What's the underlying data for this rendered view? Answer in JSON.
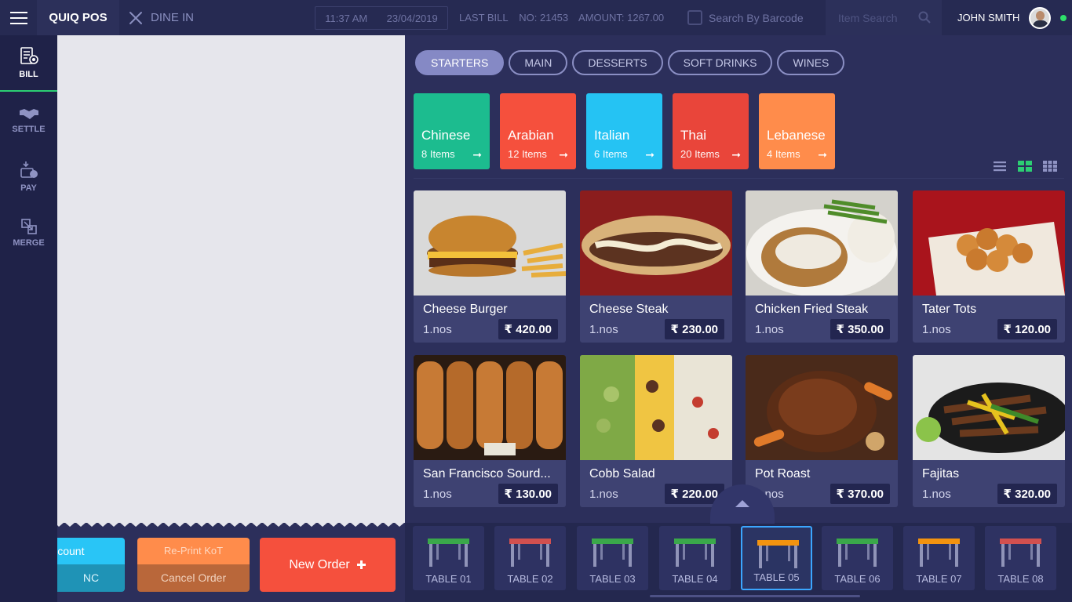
{
  "app": {
    "name": "QUIQ POS"
  },
  "header": {
    "mode_label": "DINE IN",
    "time": "11:37 AM",
    "date": "23/04/2019",
    "last_bill_label": "LAST BILL",
    "last_bill_no": "NO: 21453",
    "last_bill_amount": "AMOUNT: 1267.00",
    "barcode_label": "Search By Barcode",
    "search_placeholder": "Item Search",
    "user_name": "JOHN SMITH"
  },
  "sidebar": {
    "items": [
      {
        "label": "BILL",
        "icon": "bill-icon"
      },
      {
        "label": "SETTLE",
        "icon": "handshake-icon"
      },
      {
        "label": "PAY",
        "icon": "pay-icon"
      },
      {
        "label": "MERGE",
        "icon": "merge-icon"
      }
    ]
  },
  "actions": {
    "discount_label": "Discount",
    "nc_label": "NC",
    "reprint_label": "Re-Print KoT",
    "cancel_label": "Cancel Order",
    "new_order_label": "New Order"
  },
  "tabs": [
    "STARTERS",
    "MAIN",
    "DESSERTS",
    "SOFT DRINKS",
    "WINES"
  ],
  "cuisines": [
    {
      "name": "Chinese",
      "count": "8 Items",
      "color": "#1cbc8f"
    },
    {
      "name": "Arabian",
      "count": "12 Items",
      "color": "#f5503d"
    },
    {
      "name": "Italian",
      "count": "6 Items",
      "color": "#25c3f3"
    },
    {
      "name": "Thai",
      "count": "20 Items",
      "color": "#e9453a"
    },
    {
      "name": "Lebanese",
      "count": "4 Items",
      "color": "#ff8c4b"
    }
  ],
  "products": [
    {
      "name": "Cheese Burger",
      "qty": "1.nos",
      "price": "₹ 420.00"
    },
    {
      "name": "Cheese Steak",
      "qty": "1.nos",
      "price": "₹ 230.00"
    },
    {
      "name": "Chicken Fried Steak",
      "qty": "1.nos",
      "price": "₹ 350.00"
    },
    {
      "name": "Tater Tots",
      "qty": "1.nos",
      "price": "₹ 120.00"
    },
    {
      "name": "San Francisco Sourd...",
      "qty": "1.nos",
      "price": "₹ 130.00"
    },
    {
      "name": "Cobb Salad",
      "qty": "1.nos",
      "price": "₹ 220.00"
    },
    {
      "name": "Pot Roast",
      "qty": "1.nos",
      "price": "₹ 370.00"
    },
    {
      "name": "Fajitas",
      "qty": "1.nos",
      "price": "₹ 320.00"
    }
  ],
  "tables": [
    {
      "label": "TABLE 01",
      "status_color": "#3aa84a"
    },
    {
      "label": "TABLE 02",
      "status_color": "#d2504f"
    },
    {
      "label": "TABLE 03",
      "status_color": "#3aa84a"
    },
    {
      "label": "TABLE 04",
      "status_color": "#3aa84a"
    },
    {
      "label": "TABLE 05",
      "status_color": "#f3930f"
    },
    {
      "label": "TABLE 06",
      "status_color": "#3aa84a"
    },
    {
      "label": "TABLE 07",
      "status_color": "#f3930f"
    },
    {
      "label": "TABLE 08",
      "status_color": "#d2504f"
    }
  ]
}
